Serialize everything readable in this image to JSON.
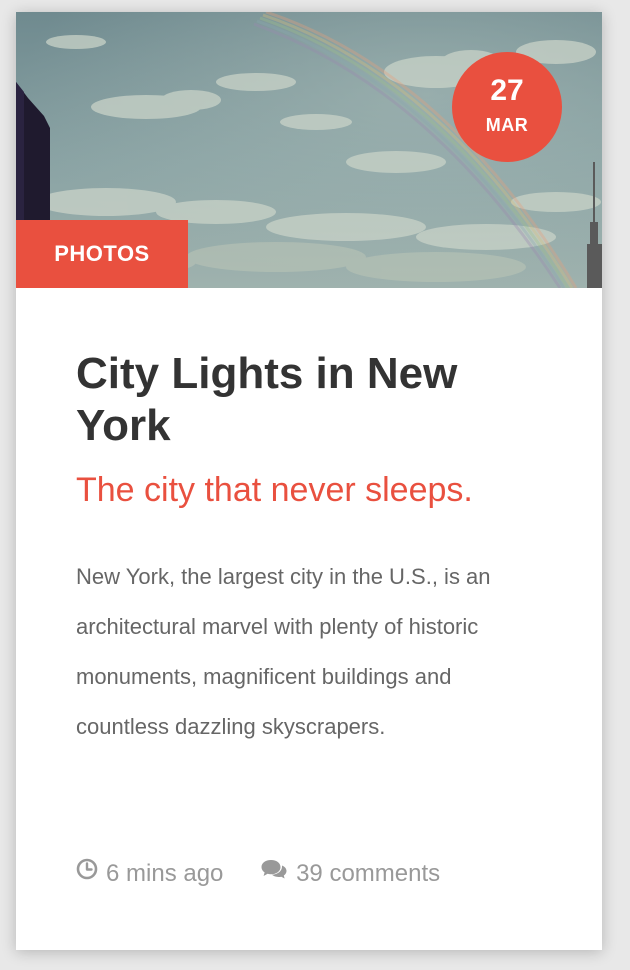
{
  "post": {
    "date": {
      "day": "27",
      "month": "MAR"
    },
    "category": "PHOTOS",
    "title": "City Lights in New York",
    "subtitle": "The city that never sleeps.",
    "excerpt": "New York, the largest city in the U.S., is an architectural marvel with plenty of historic monuments, magnificent buildings and countless dazzling skyscrapers.",
    "meta": {
      "time_ago": "6 mins ago",
      "comments": "39 comments",
      "time_icon": "clock-icon",
      "comments_icon": "comments-icon"
    }
  },
  "colors": {
    "accent": "#e9503f",
    "title": "#333333",
    "body": "#666666",
    "meta": "#999999"
  }
}
